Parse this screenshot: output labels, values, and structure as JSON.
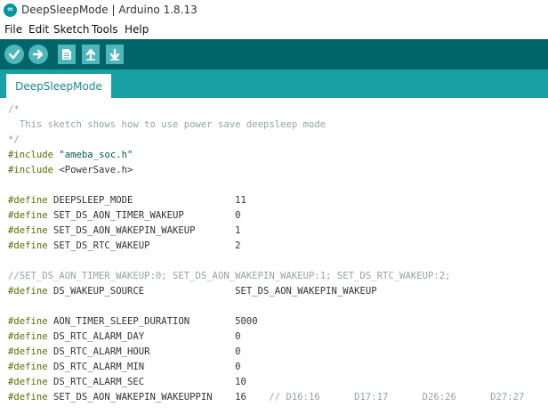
{
  "window": {
    "title": "DeepSleepMode | Arduino 1.8.13"
  },
  "menu": {
    "items": [
      "File",
      "Edit",
      "Sketch",
      "Tools",
      "Help"
    ]
  },
  "toolbar": {
    "buttons": [
      {
        "name": "verify",
        "icon": "checkmark-icon"
      },
      {
        "name": "upload",
        "icon": "arrow-right-icon"
      },
      {
        "name": "new",
        "icon": "new-file-icon"
      },
      {
        "name": "open",
        "icon": "arrow-up-icon"
      },
      {
        "name": "save",
        "icon": "arrow-down-icon"
      }
    ]
  },
  "tab": {
    "label": "DeepSleepMode"
  },
  "colors": {
    "toolbar": "#006468",
    "tabbar": "#17a1a5",
    "button": "#4db7bb",
    "comment": "#95a5a6",
    "keyword": "#5e6d03",
    "string": "#005c5f"
  },
  "code": [
    [
      {
        "t": "/*",
        "c": "comment"
      }
    ],
    [
      {
        "t": "  This sketch shows how to use power save deepsleep mode",
        "c": "comment"
      }
    ],
    [
      {
        "t": "*/",
        "c": "comment"
      }
    ],
    [
      {
        "t": "#include",
        "c": "kw"
      },
      {
        "t": " ",
        "c": "plain"
      },
      {
        "t": "\"ameba_soc.h\"",
        "c": "str"
      }
    ],
    [
      {
        "t": "#include",
        "c": "kw"
      },
      {
        "t": " <PowerSave.h>",
        "c": "plain"
      }
    ],
    [],
    [
      {
        "t": "#define",
        "c": "kw"
      },
      {
        "t": " DEEPSLEEP_MODE                  11",
        "c": "plain"
      }
    ],
    [
      {
        "t": "#define",
        "c": "kw"
      },
      {
        "t": " SET_DS_AON_TIMER_WAKEUP         0",
        "c": "plain"
      }
    ],
    [
      {
        "t": "#define",
        "c": "kw"
      },
      {
        "t": " SET_DS_AON_WAKEPIN_WAKEUP       1",
        "c": "plain"
      }
    ],
    [
      {
        "t": "#define",
        "c": "kw"
      },
      {
        "t": " SET_DS_RTC_WAKEUP               2",
        "c": "plain"
      }
    ],
    [],
    [
      {
        "t": "//SET_DS_AON_TIMER_WAKEUP:0; SET_DS_AON_WAKEPIN_WAKEUP:1; SET_DS_RTC_WAKEUP:2;",
        "c": "comment"
      }
    ],
    [
      {
        "t": "#define",
        "c": "kw"
      },
      {
        "t": " DS_WAKEUP_SOURCE                SET_DS_AON_WAKEPIN_WAKEUP",
        "c": "plain"
      }
    ],
    [],
    [
      {
        "t": "#define",
        "c": "kw"
      },
      {
        "t": " AON_TIMER_SLEEP_DURATION        5000",
        "c": "plain"
      }
    ],
    [
      {
        "t": "#define",
        "c": "kw"
      },
      {
        "t": " DS_RTC_ALARM_DAY                0",
        "c": "plain"
      }
    ],
    [
      {
        "t": "#define",
        "c": "kw"
      },
      {
        "t": " DS_RTC_ALARM_HOUR               0",
        "c": "plain"
      }
    ],
    [
      {
        "t": "#define",
        "c": "kw"
      },
      {
        "t": " DS_RTC_ALARM_MIN                0",
        "c": "plain"
      }
    ],
    [
      {
        "t": "#define",
        "c": "kw"
      },
      {
        "t": " DS_RTC_ALARM_SEC                10",
        "c": "plain"
      }
    ],
    [
      {
        "t": "#define",
        "c": "kw"
      },
      {
        "t": " SET_DS_AON_WAKEPIN_WAKEUPPIN    16    ",
        "c": "plain"
      },
      {
        "t": "// D16:16      D17:17      D26:26      D27:27",
        "c": "comment"
      }
    ]
  ]
}
